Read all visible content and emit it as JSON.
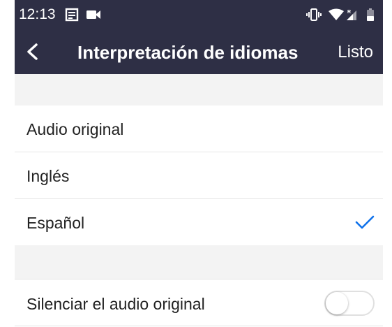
{
  "status_bar": {
    "time": "12:13",
    "left_icons": [
      "news-icon",
      "video-camera-icon"
    ],
    "right_icons": [
      "vibrate-icon",
      "wifi-icon",
      "signal-roaming-icon",
      "battery-icon"
    ]
  },
  "nav": {
    "title": "Interpretación de idiomas",
    "done_label": "Listo",
    "back_icon": "chevron-left-icon"
  },
  "languages": [
    {
      "label": "Audio original",
      "selected": false
    },
    {
      "label": "Inglés",
      "selected": false
    },
    {
      "label": "Español",
      "selected": true
    }
  ],
  "mute_original": {
    "label": "Silenciar el audio original",
    "enabled": false
  },
  "colors": {
    "nav_background": "#2e2f45",
    "accent": "#0e71eb",
    "section_background": "#f3f3f3"
  }
}
